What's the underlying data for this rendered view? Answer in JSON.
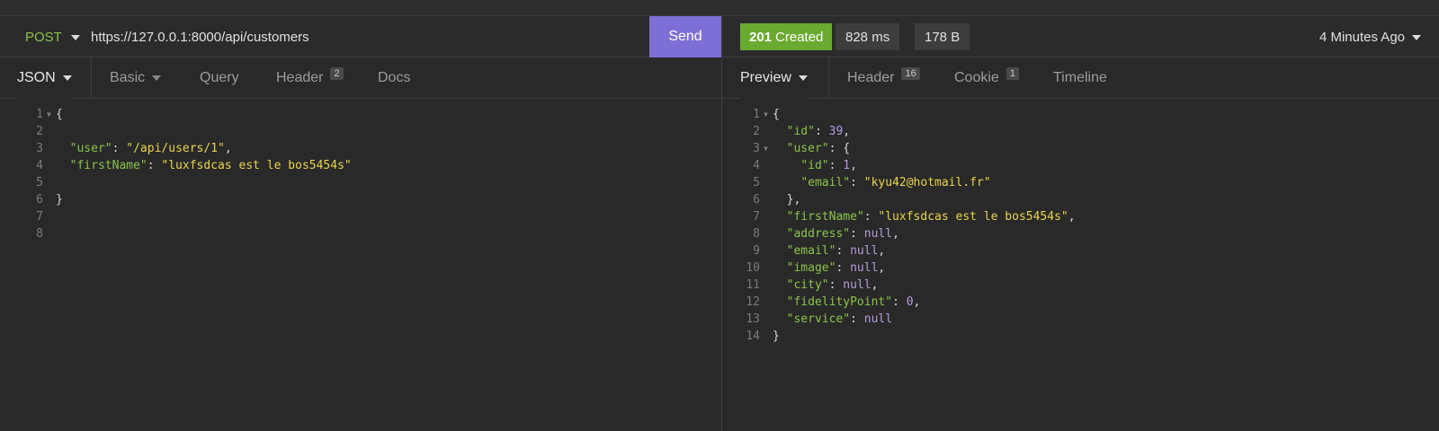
{
  "request": {
    "method": "POST",
    "url": "https://127.0.0.1:8000/api/customers",
    "send_label": "Send",
    "tabs": [
      {
        "label": "JSON"
      },
      {
        "label": "Basic"
      },
      {
        "label": "Query"
      },
      {
        "label": "Header",
        "badge": "2"
      },
      {
        "label": "Docs"
      }
    ],
    "line_numbers": [
      "1",
      "2",
      "3",
      "4",
      "5",
      "6",
      "7",
      "8"
    ],
    "body": {
      "brace_open": "{",
      "user_key": "\"user\"",
      "user_val": "\"/api/users/1\"",
      "first_key": "\"firstName\"",
      "first_val": "\"luxfsdcas est le bos5454s\"",
      "brace_close": "}"
    }
  },
  "response": {
    "status_code": "201",
    "status_text": "Created",
    "time": "828 ms",
    "size": "178 B",
    "timestamp": "4 Minutes Ago",
    "tabs": [
      {
        "label": "Preview"
      },
      {
        "label": "Header",
        "badge": "16"
      },
      {
        "label": "Cookie",
        "badge": "1"
      },
      {
        "label": "Timeline"
      }
    ],
    "line_numbers": [
      "1",
      "2",
      "3",
      "4",
      "5",
      "6",
      "7",
      "8",
      "9",
      "10",
      "11",
      "12",
      "13",
      "14"
    ],
    "body": {
      "id_key": "\"id\"",
      "id_val": "39",
      "user_key": "\"user\"",
      "user_id_key": "\"id\"",
      "user_id_val": "1",
      "user_email_key": "\"email\"",
      "user_email_val": "\"kyu42@hotmail.fr\"",
      "first_key": "\"firstName\"",
      "first_val": "\"luxfsdcas est le bos5454s\"",
      "address_key": "\"address\"",
      "address_val": "null",
      "email_key": "\"email\"",
      "email_val": "null",
      "image_key": "\"image\"",
      "image_val": "null",
      "city_key": "\"city\"",
      "city_val": "null",
      "fidelity_key": "\"fidelityPoint\"",
      "fidelity_val": "0",
      "service_key": "\"service\"",
      "service_val": "null"
    }
  },
  "colors": {
    "accent": "#7e6fd6",
    "status_ok": "#6aaa30",
    "json_key": "#8bc34a",
    "json_string": "#e8d44d",
    "json_number": "#b39ddb"
  }
}
